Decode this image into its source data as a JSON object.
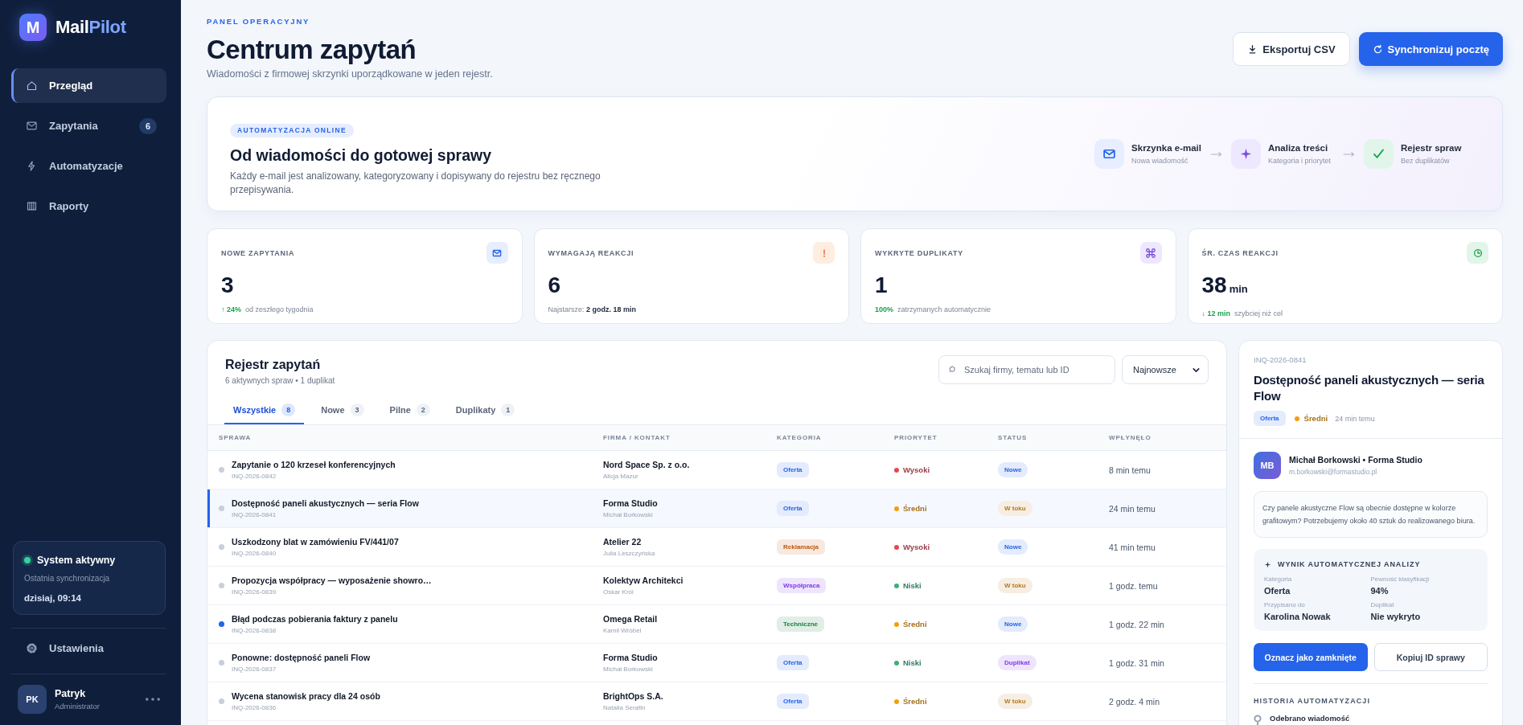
{
  "sidebar": {
    "brand": {
      "mark": "M",
      "name": "Mail",
      "accent": "Pilot"
    },
    "nav": [
      {
        "label": "Przegląd",
        "selected": true
      },
      {
        "label": "Zapytania",
        "selected": false,
        "badge": "6"
      },
      {
        "label": "Automatyzacje",
        "selected": false
      },
      {
        "label": "Raporty",
        "selected": false
      }
    ],
    "system": {
      "status": "System aktywny",
      "online": true,
      "caption": "Ostatnia synchronizacja",
      "time": "dzisiaj, 09:14"
    },
    "settings": {
      "label": "Ustawienia"
    },
    "user": {
      "initials": "PK",
      "name": "Patryk",
      "role": "Administrator"
    }
  },
  "header": {
    "eyebrow": "PANEL OPERACYJNY",
    "title": "Centrum zapytań",
    "subtitle": "Wiadomości z firmowej skrzynki uporządkowane w jeden rejestr.",
    "buttons": [
      {
        "label": "Eksportuj CSV",
        "kind": "secondary"
      },
      {
        "label": "Synchronizuj pocztę",
        "kind": "primary"
      }
    ]
  },
  "hero": {
    "badge": "AUTOMATYZACJA ONLINE",
    "title": "Od wiadomości do gotowej sprawy",
    "description": "Każdy e-mail jest analizowany, kategoryzowany i dopisywany do rejestru bez ręcznego przepisywania.",
    "steps": [
      {
        "title": "Skrzynka e-mail",
        "subtitle": "Nowa wiadomość"
      },
      {
        "title": "Analiza treści",
        "subtitle": "Kategoria i priorytet"
      },
      {
        "title": "Rejestr spraw",
        "subtitle": "Bez duplikatów"
      }
    ]
  },
  "stats": [
    {
      "label": "NOWE ZAPYTANIA",
      "value": "3",
      "footer": "**↑ 24%**  od zeszłego tygodnia",
      "positive": true
    },
    {
      "label": "WYMAGAJĄ REAKCJI",
      "value": "6",
      "footer": "Najstarsze: **2 godz. 18 min**",
      "positive": false
    },
    {
      "label": "WYKRYTE DUPLIKATY",
      "value": "1",
      "footer": "**100%**  zatrzymanych automatycznie",
      "positive": true
    },
    {
      "label": "ŚR. CZAS REAKCJI",
      "value": "38",
      "unit": "min",
      "footer": "**↓ 12 min**  szybciej niż cel",
      "positive": true
    }
  ],
  "table": {
    "title": "Rejestr zapytań",
    "subtitle": "6 aktywnych spraw • 1 duplikat",
    "search": {
      "placeholder": "Szukaj firmy, tematu lub ID"
    },
    "sort": {
      "value": "Najnowsze"
    },
    "tabs": [
      {
        "label": "Wszystkie",
        "count": "8",
        "selected": true
      },
      {
        "label": "Nowe",
        "count": "3",
        "selected": false
      },
      {
        "label": "Pilne",
        "count": "2",
        "selected": false
      },
      {
        "label": "Duplikaty",
        "count": "1",
        "selected": false
      }
    ],
    "columns": [
      "SPRAWA",
      "FIRMA / KONTAKT",
      "KATEGORIA",
      "PRIORYTET",
      "STATUS",
      "WPŁYNĘŁO"
    ],
    "rows": [
      {
        "title": "Zapytanie o 120 krzeseł konferencyjnych",
        "id": "INQ-2026-0842",
        "company": "Nord Space Sp. z o.o.",
        "contact": "Alicja Mazur",
        "category": {
          "label": "Oferta",
          "color": "#2563eb"
        },
        "priority": {
          "label": "Wysoki",
          "color": "#e5484d"
        },
        "status": {
          "label": "Nowe",
          "color": "#2563eb"
        },
        "received": "8 min temu",
        "selected": false,
        "unread": false
      },
      {
        "title": "Dostępność paneli akustycznych — seria Flow",
        "id": "INQ-2026-0841",
        "company": "Forma Studio",
        "contact": "Michał Borkowski",
        "category": {
          "label": "Oferta",
          "color": "#2563eb"
        },
        "priority": {
          "label": "Średni",
          "color": "#f59e0b"
        },
        "status": {
          "label": "W toku",
          "color": "#b7791f"
        },
        "received": "24 min temu",
        "selected": true,
        "unread": false
      },
      {
        "title": "Uszkodzony blat w zamówieniu FV/441/07",
        "id": "INQ-2026-0840",
        "company": "Atelier 22",
        "contact": "Julia Leszczyńska",
        "category": {
          "label": "Reklamacja",
          "color": "#c2570c"
        },
        "priority": {
          "label": "Wysoki",
          "color": "#e5484d"
        },
        "status": {
          "label": "Nowe",
          "color": "#2563eb"
        },
        "received": "41 min temu",
        "selected": false,
        "unread": false
      },
      {
        "title": "Propozycja współpracy — wyposażenie showro…",
        "id": "INQ-2026-0839",
        "company": "Kolektyw Architekci",
        "contact": "Oskar Król",
        "category": {
          "label": "Współpraca",
          "color": "#7c3aed"
        },
        "priority": {
          "label": "Niski",
          "color": "#3fae7a"
        },
        "status": {
          "label": "W toku",
          "color": "#b7791f"
        },
        "received": "1 godz. temu",
        "selected": false,
        "unread": false
      },
      {
        "title": "Błąd podczas pobierania faktury z panelu",
        "id": "INQ-2026-0838",
        "company": "Omega Retail",
        "contact": "Kamil Wróbel",
        "category": {
          "label": "Techniczne",
          "color": "#15803d"
        },
        "priority": {
          "label": "Średni",
          "color": "#f59e0b"
        },
        "status": {
          "label": "Nowe",
          "color": "#2563eb"
        },
        "received": "1 godz. 22 min",
        "selected": false,
        "unread": true
      },
      {
        "title": "Ponowne: dostępność paneli Flow",
        "id": "INQ-2026-0837",
        "company": "Forma Studio",
        "contact": "Michał Borkowski",
        "category": {
          "label": "Oferta",
          "color": "#2563eb"
        },
        "priority": {
          "label": "Niski",
          "color": "#3fae7a"
        },
        "status": {
          "label": "Duplikat",
          "color": "#7c3aed"
        },
        "received": "1 godz. 31 min",
        "selected": false,
        "unread": false
      },
      {
        "title": "Wycena stanowisk pracy dla 24 osób",
        "id": "INQ-2026-0836",
        "company": "BrightOps S.A.",
        "contact": "Natalia Serafin",
        "category": {
          "label": "Oferta",
          "color": "#2563eb"
        },
        "priority": {
          "label": "Średni",
          "color": "#f59e0b"
        },
        "status": {
          "label": "W toku",
          "color": "#b7791f"
        },
        "received": "2 godz. 4 min",
        "selected": false,
        "unread": false
      }
    ]
  },
  "detail": {
    "id": "INQ-2026-0841",
    "title": "Dostępność paneli akustycznych — seria Flow",
    "category": {
      "label": "Oferta",
      "color": "#2563eb"
    },
    "priority": {
      "label": "Średni",
      "color": "#f59e0b"
    },
    "received": "24 min temu",
    "sender": {
      "initials": "MB",
      "name": "Michał Borkowski • Forma Studio",
      "email": "m.borkowski@formastudio.pl"
    },
    "message": "Czy panele akustyczne Flow są obecnie dostępne w kolorze grafitowym? Potrzebujemy około 40 sztuk do realizowanego biura.",
    "analysis": {
      "title": "WYNIK AUTOMATYCZNEJ ANALIZY",
      "fields": [
        {
          "label": "Kategoria",
          "value": "Oferta"
        },
        {
          "label": "Pewność klasyfikacji",
          "value": "94%"
        },
        {
          "label": "Przypisano do",
          "value": "Karolina Nowak"
        },
        {
          "label": "Duplikat",
          "value": "Nie wykryto"
        }
      ]
    },
    "actions": [
      {
        "label": "Oznacz jako zamknięte",
        "kind": "primary"
      },
      {
        "label": "Kopiuj ID sprawy",
        "kind": "secondary"
      }
    ],
    "history": {
      "title": "HISTORIA AUTOMATYZACJI",
      "items": [
        {
          "title": "Odebrano wiadomość"
        }
      ]
    }
  }
}
